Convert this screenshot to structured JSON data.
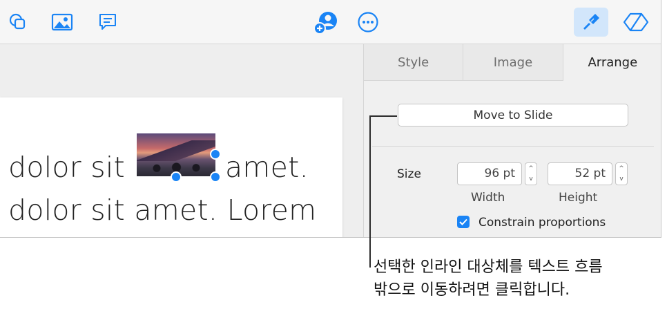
{
  "toolbar": {
    "icons": [
      "shape-icon",
      "image-icon",
      "comment-icon",
      "collaborate-icon",
      "more-icon",
      "format-icon",
      "document-icon"
    ]
  },
  "slide": {
    "line1_left": "dolor sit",
    "line1_right": "amet.",
    "line2": "dolor sit amet. Lorem"
  },
  "panel": {
    "tabs": [
      "Style",
      "Image",
      "Arrange"
    ],
    "active_tab": "Arrange",
    "move_button": "Move to Slide",
    "size_label": "Size",
    "width_value": "96 pt",
    "height_value": "52 pt",
    "width_label": "Width",
    "height_label": "Height",
    "constrain_label": "Constrain proportions",
    "constrain_checked": true
  },
  "callout": {
    "line1": "선택한 인라인 대상체를 텍스트 흐름",
    "line2": "밖으로 이동하려면 클릭합니다."
  },
  "colors": {
    "accent": "#1a84f5",
    "active_tool_bg": "#d2e6fb"
  }
}
